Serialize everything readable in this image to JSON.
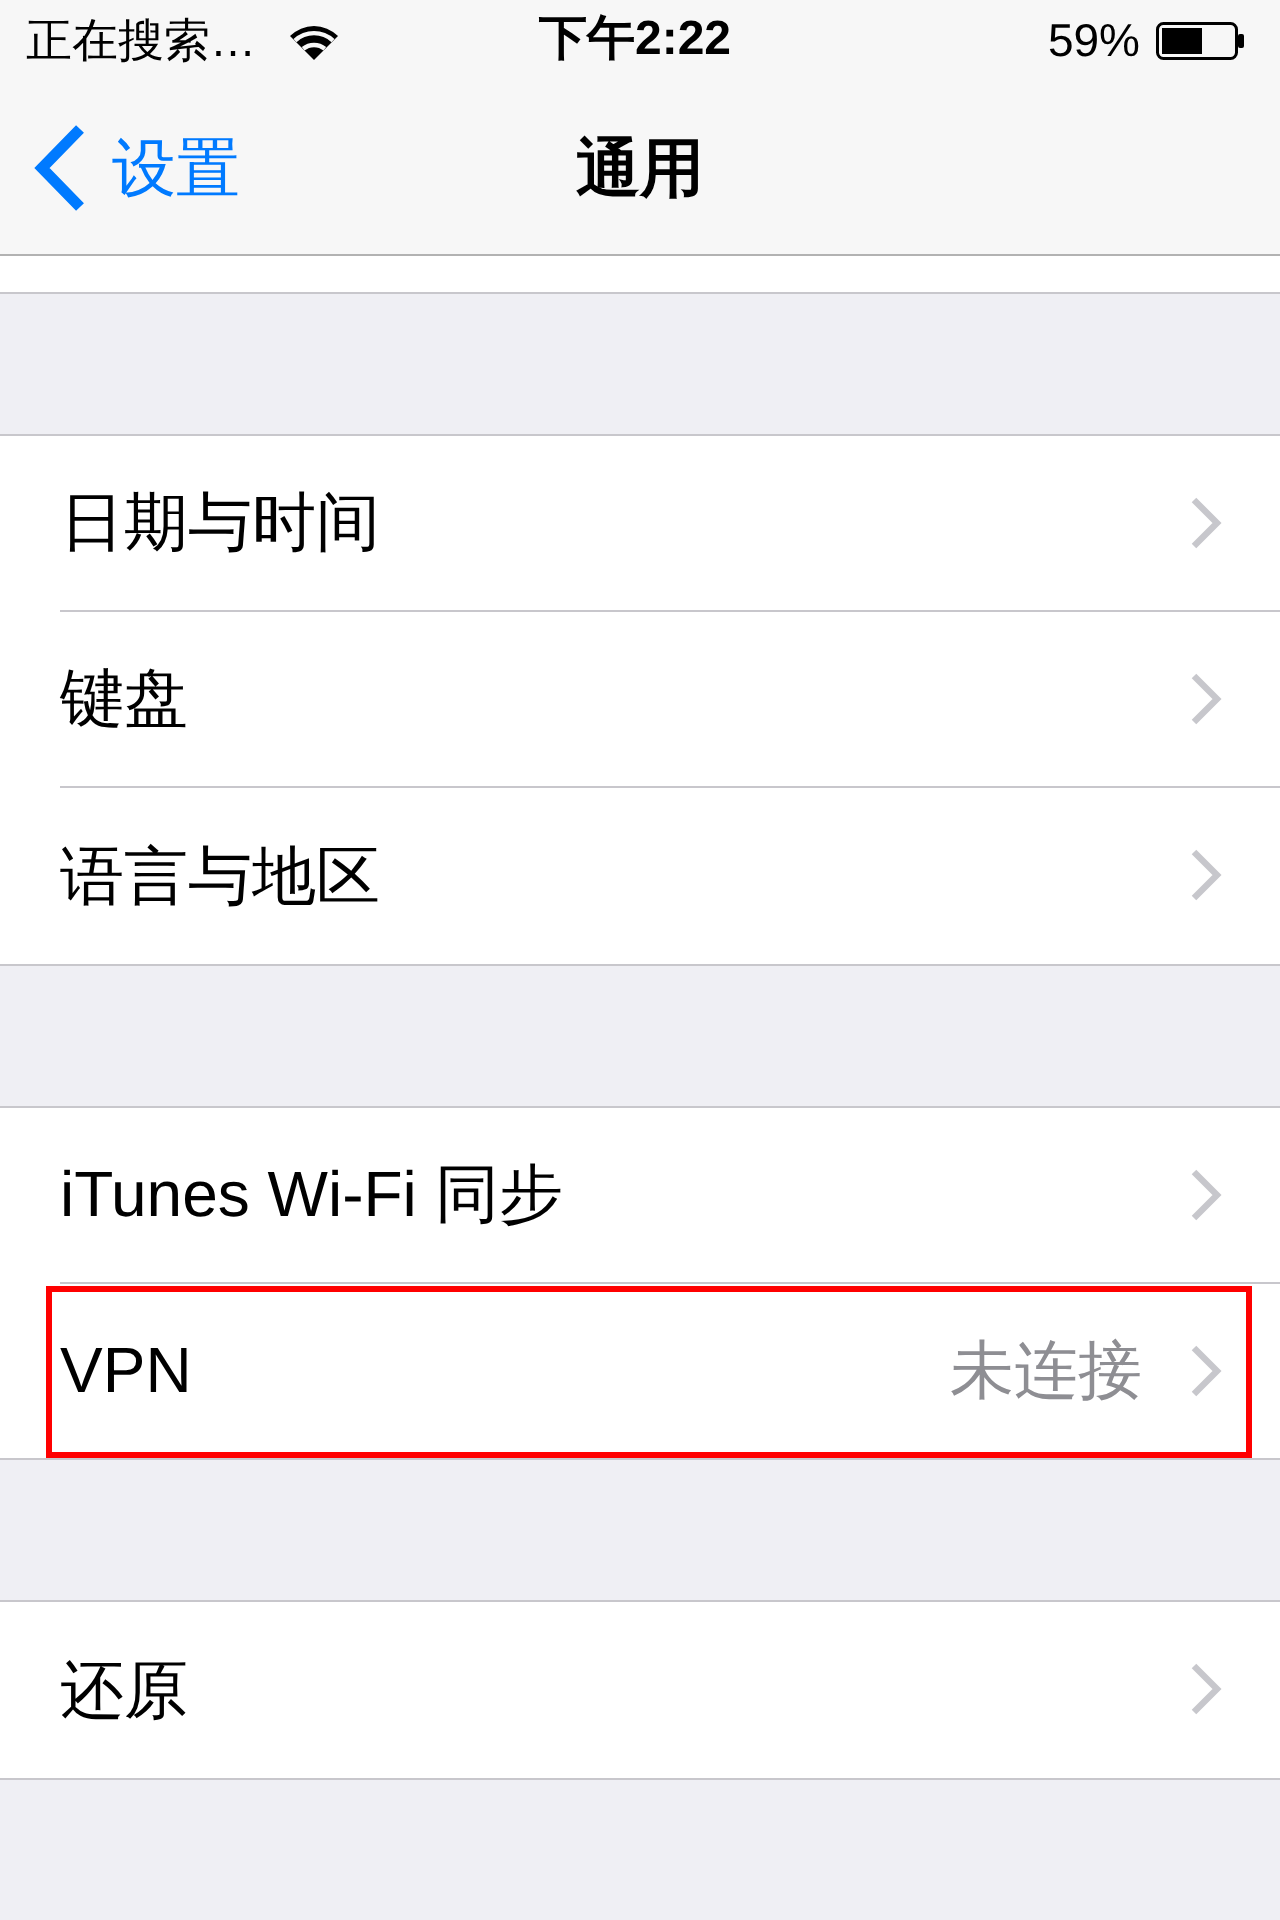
{
  "status_bar": {
    "carrier": "正在搜索…",
    "time": "下午2:22",
    "battery": "59%"
  },
  "nav_bar": {
    "back": "设置",
    "title": "通用"
  },
  "groups": [
    {
      "rows": [
        {
          "label": "日期与时间",
          "highlighted": false
        },
        {
          "label": "键盘",
          "highlighted": false
        },
        {
          "label": "语言与地区",
          "highlighted": false
        }
      ]
    },
    {
      "rows": [
        {
          "label": "iTunes Wi-Fi 同步",
          "highlighted": false
        },
        {
          "label": "VPN",
          "detail": "未连接",
          "highlighted": true
        }
      ]
    },
    {
      "rows": [
        {
          "label": "还原",
          "highlighted": false
        }
      ]
    }
  ]
}
